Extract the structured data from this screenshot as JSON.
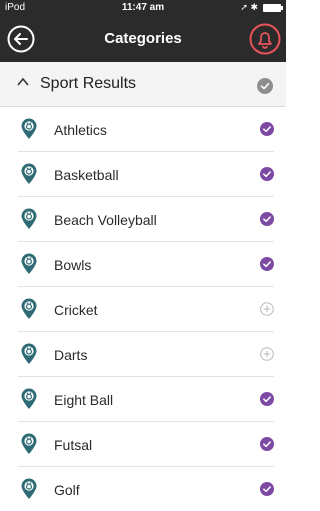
{
  "status_bar": {
    "carrier": "iPod",
    "time": "11:47 am"
  },
  "nav": {
    "title": "Categories",
    "back_icon": "back-arrow-circle-icon",
    "notifications_icon": "bell-icon"
  },
  "colors": {
    "header_bg": "#2b2b2b",
    "accent_purple": "#7d4aa3",
    "pin_teal": "#2e6b74",
    "bell_red": "#e8545a",
    "check_gray": "#8e8e8e"
  },
  "section": {
    "title": "Sport Results",
    "selected": true
  },
  "categories": [
    {
      "label": "Athletics",
      "selected": true
    },
    {
      "label": "Basketball",
      "selected": true
    },
    {
      "label": "Beach Volleyball",
      "selected": true
    },
    {
      "label": "Bowls",
      "selected": true
    },
    {
      "label": "Cricket",
      "selected": false
    },
    {
      "label": "Darts",
      "selected": false
    },
    {
      "label": "Eight Ball",
      "selected": true
    },
    {
      "label": "Futsal",
      "selected": true
    },
    {
      "label": "Golf",
      "selected": true
    }
  ]
}
